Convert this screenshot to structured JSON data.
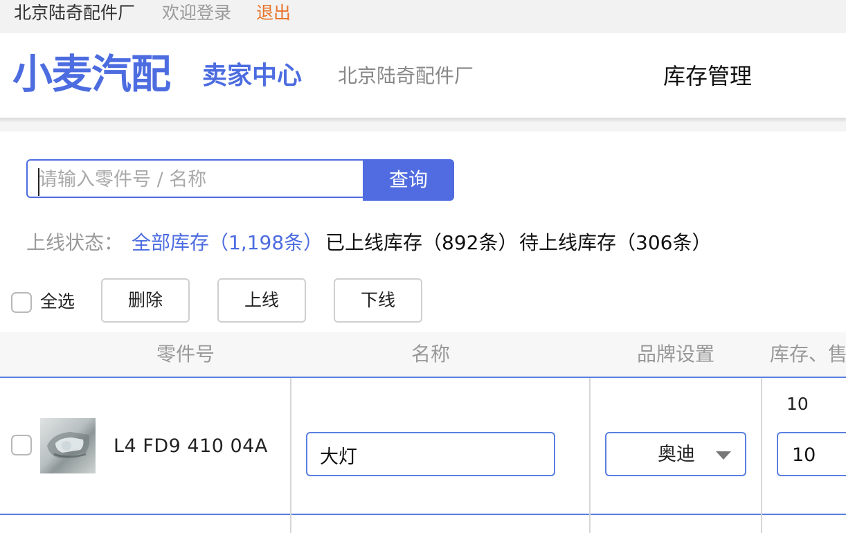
{
  "topbar": {
    "shop_name": "北京陆奇配件厂",
    "welcome": "欢迎登录",
    "logout": "退出"
  },
  "header": {
    "logo": "小麦汽配",
    "logo_sub": "卖家中心",
    "shop_name": "北京陆奇配件厂",
    "nav_inventory": "库存管理"
  },
  "search": {
    "placeholder": "请输入零件号 / 名称",
    "value": "",
    "button": "查询"
  },
  "status_filter": {
    "label": "上线状态：",
    "all": "全部库存（1,198条）",
    "online": "已上线库存（892条）",
    "pending": "待上线库存（306条）"
  },
  "actions": {
    "select_all": "全选",
    "delete": "删除",
    "online": "上线",
    "offline": "下线"
  },
  "table": {
    "headers": [
      "零件号",
      "名称",
      "品牌设置",
      "库存、售"
    ],
    "rows": [
      {
        "part_no": "L4 FD9 410 04A",
        "name": "大灯",
        "brand": "奥迪",
        "stock_text": "10",
        "stock_input": "10"
      }
    ]
  },
  "colors": {
    "accent": "#4c6ce0",
    "logout": "#e8742c"
  }
}
